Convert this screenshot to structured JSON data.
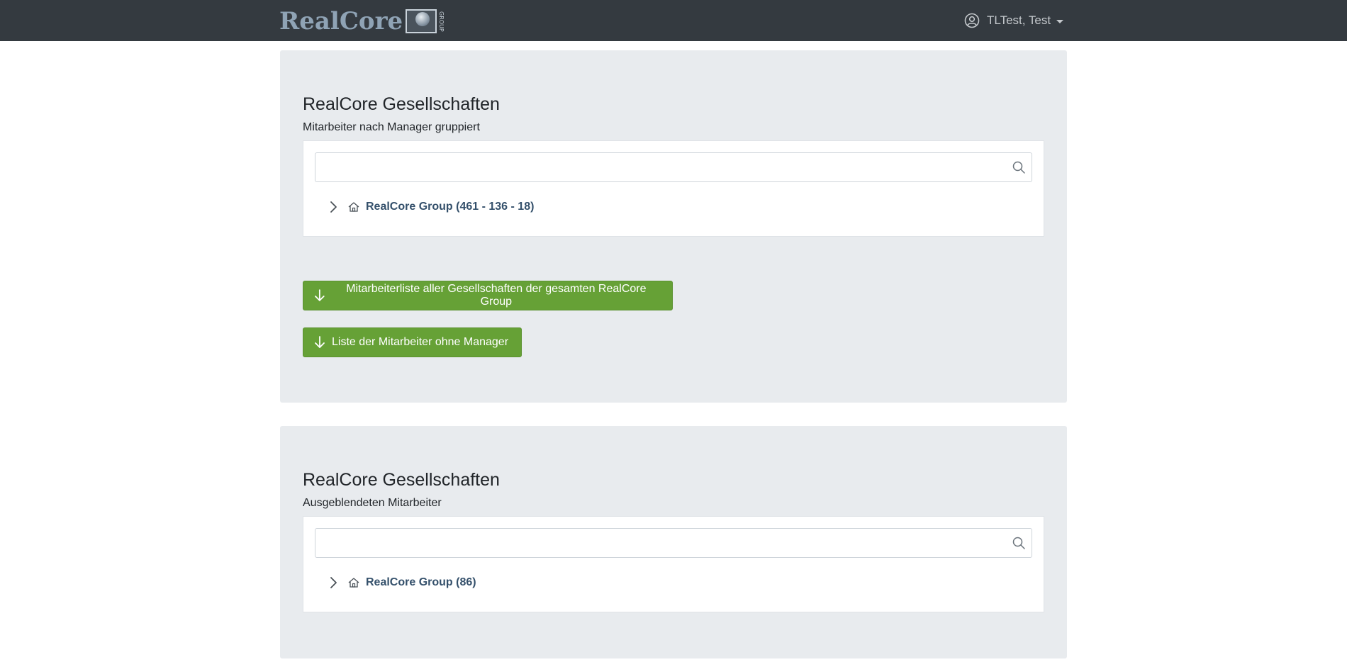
{
  "navbar": {
    "logo_text": "RealCore",
    "logo_sub": "GROUP",
    "user_name": "TLTest, Test"
  },
  "section1": {
    "title": "RealCore Gesellschaften",
    "subtitle": "Mitarbeiter nach Manager gruppiert",
    "search_value": "",
    "tree_root_label": "RealCore Group (461 - 136 - 18)",
    "buttons": [
      "Mitarbeiterliste aller Gesellschaften der gesamten RealCore Group",
      "Liste der Mitarbeiter ohne Manager"
    ]
  },
  "section2": {
    "title": "RealCore Gesellschaften",
    "subtitle": "Ausgeblendeten Mitarbeiter",
    "search_value": "",
    "tree_root_label": "RealCore Group (86)"
  },
  "colors": {
    "navbar_bg": "#343a40",
    "card_bg": "#e8ebee",
    "button_green": "#66a136",
    "tree_label": "#34506b"
  },
  "icons": [
    "user-circle-icon",
    "caret-down-icon",
    "search-icon",
    "chevron-right-icon",
    "home-icon",
    "arrow-down-icon"
  ]
}
